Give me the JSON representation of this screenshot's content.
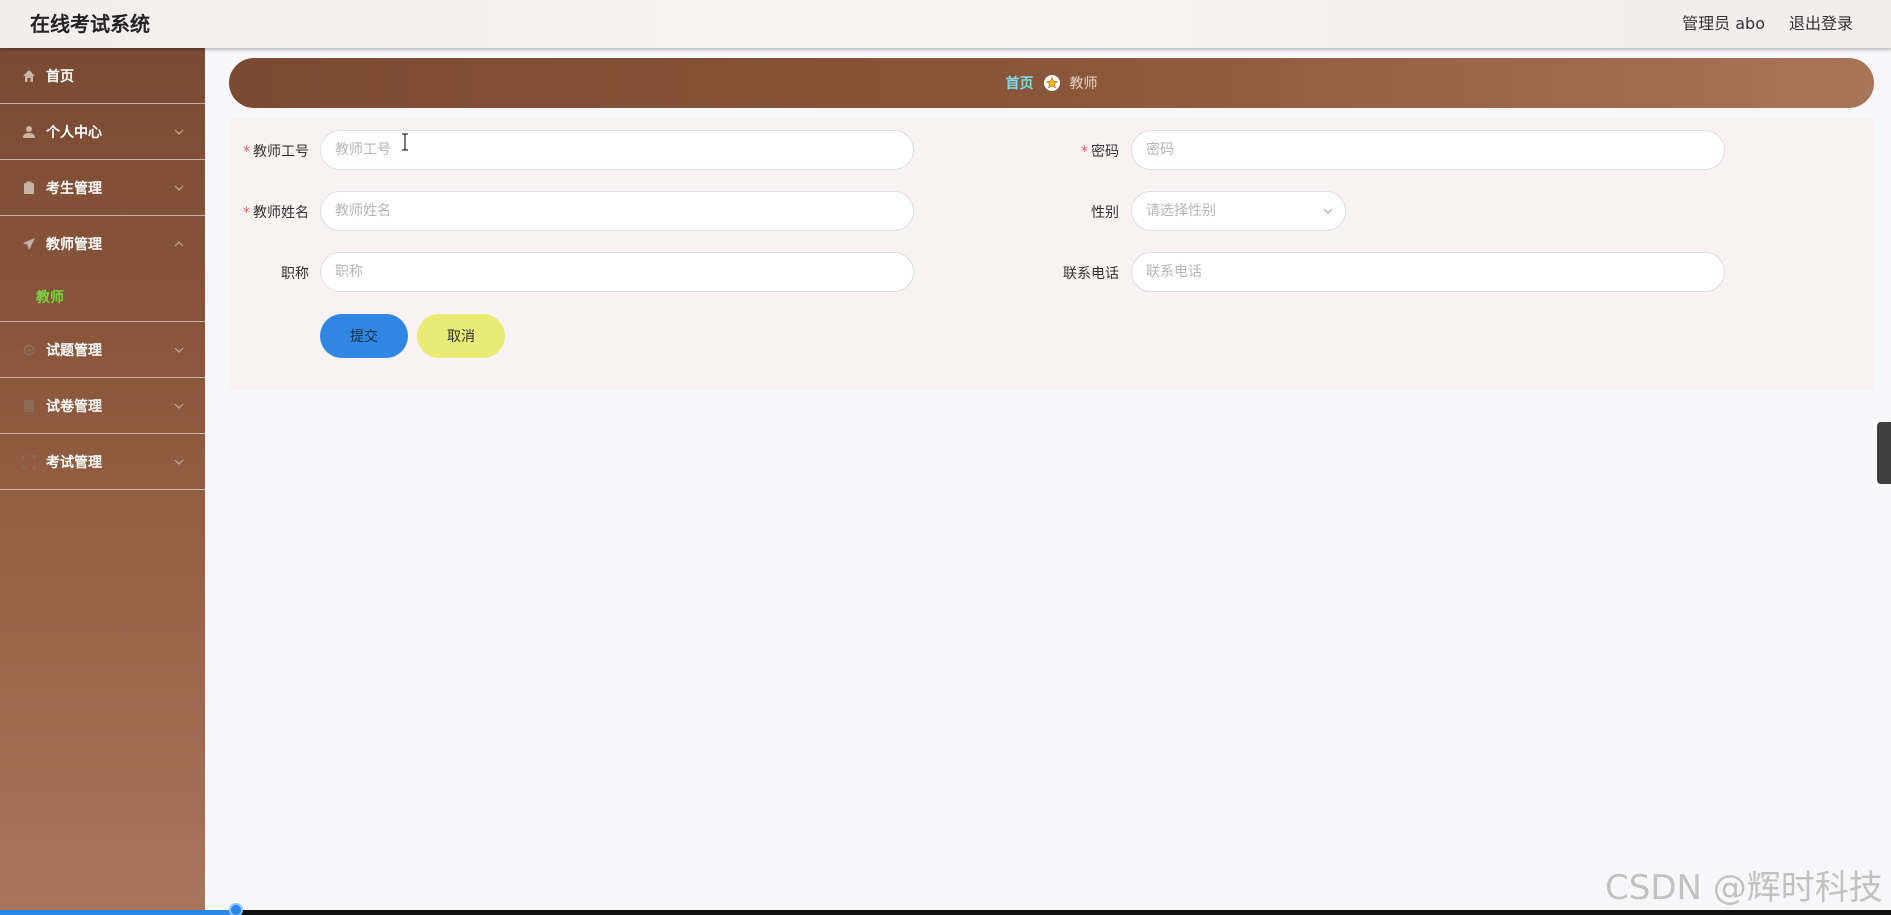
{
  "header": {
    "title": "在线考试系统",
    "user": "管理员 abo",
    "logout": "退出登录"
  },
  "sidebar": {
    "items": [
      {
        "label": "首页",
        "icon": "home-icon"
      },
      {
        "label": "个人中心",
        "icon": "user-icon"
      },
      {
        "label": "考生管理",
        "icon": "clipboard-icon"
      },
      {
        "label": "教师管理",
        "icon": "paper-plane-icon",
        "expanded": true
      },
      {
        "label": "试题管理",
        "icon": "gear-icon"
      },
      {
        "label": "试卷管理",
        "icon": "book-icon"
      },
      {
        "label": "考试管理",
        "icon": "frame-icon"
      }
    ],
    "subitem": "教师"
  },
  "breadcrumb": {
    "home": "首页",
    "current": "教师"
  },
  "form": {
    "teacher_no": {
      "label": "教师工号",
      "placeholder": "教师工号",
      "required": true
    },
    "password": {
      "label": "密码",
      "placeholder": "密码",
      "required": true
    },
    "teacher_name": {
      "label": "教师姓名",
      "placeholder": "教师姓名",
      "required": true
    },
    "gender": {
      "label": "性别",
      "placeholder": "请选择性别"
    },
    "title": {
      "label": "职称",
      "placeholder": "职称"
    },
    "phone": {
      "label": "联系电话",
      "placeholder": "联系电话"
    },
    "submit": "提交",
    "cancel": "取消"
  },
  "colors": {
    "sidebar_top": "#7a4a32",
    "sidebar_bottom": "#a8765c",
    "submit": "#2f86e3",
    "cancel": "#e8ec75",
    "active_sub": "#7cd23f",
    "breadcrumb_home": "#7fdcea"
  },
  "progress": {
    "fraction": 0.125
  },
  "watermark": "CSDN @辉时科技"
}
